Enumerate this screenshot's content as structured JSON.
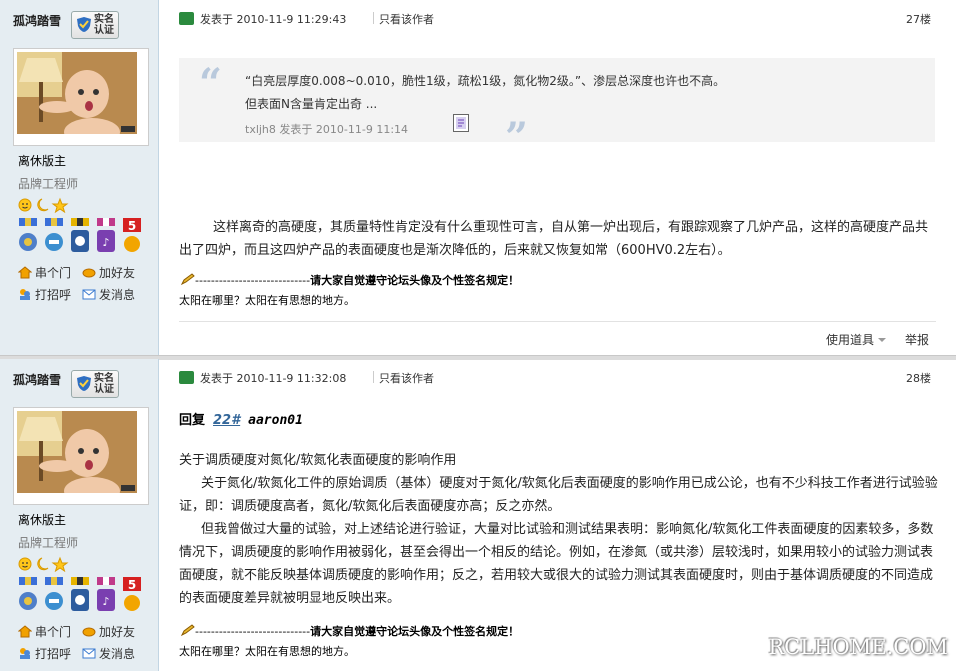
{
  "posts": [
    {
      "author": "孤鸿踏雪",
      "badge_line1": "实名",
      "badge_line2": "认证",
      "rank": "离休版主",
      "title": "品牌工程师",
      "links": {
        "home": "串个门",
        "friend": "加好友",
        "greet": "打招呼",
        "message": "发消息"
      },
      "posted": "发表于 2010-11-9 11:29:43",
      "only_author": "只看该作者",
      "floor": "27楼",
      "quote_line1": "“白亮层厚度0.008~0.010，脆性1级，疏松1级，氮化物2级。”、渗层总深度也许也不高。",
      "quote_line2": "但表面N含量肯定出奇 ...",
      "quote_by": "txljh8 发表于 2010-11-9 11:14",
      "body": "这样离奇的高硬度，其质量特性肯定没有什么重现性可言，自从第一炉出现后，有跟踪观察了几炉产品，这样的高硬度产品共出了四炉，而且这四炉产品的表面硬度也是渐次降低的，后来就又恢复如常（600HV0.2左右）。",
      "sig_dashes": "-----------------------------",
      "sig_rule": "请大家自觉遵守论坛头像及个性签名规定！",
      "motto": "太阳在哪里？太阳在有思想的地方。",
      "tools": "使用道具",
      "report": "举报"
    },
    {
      "author": "孤鸿踏雪",
      "badge_line1": "实名",
      "badge_line2": "认证",
      "rank": "离休版主",
      "title": "品牌工程师",
      "links": {
        "home": "串个门",
        "friend": "加好友",
        "greet": "打招呼",
        "message": "发消息"
      },
      "posted": "发表于 2010-11-9 11:32:08",
      "only_author": "只看该作者",
      "floor": "28楼",
      "reply_label": "回复",
      "reply_floor": "22#",
      "reply_to": "aaron01",
      "p1": "关于调质硬度对氮化/软氮化表面硬度的影响作用",
      "p2": "关于氮化/软氮化工件的原始调质（基体）硬度对于氮化/软氮化后表面硬度的影响作用已成公论，也有不少科技工作者进行试验验证，即：调质硬度高者，氮化/软氮化后表面硬度亦高；反之亦然。",
      "p3": "但我曾做过大量的试验，对上述结论进行验证，大量对比试验和测试结果表明：影响氮化/软氮化工件表面硬度的因素较多，多数情况下，调质硬度的影响作用被弱化，甚至会得出一个相反的结论。例如，在渗氮（或共渗）层较浅时，如果用较小的试验力测试表面硬度，就不能反映基体调质硬度的影响作用；反之，若用较大或很大的试验力测试其表面硬度时，则由于基体调质硬度的不同造成的表面硬度差异就被明显地反映出来。",
      "sig_dashes": "-----------------------------",
      "sig_rule": "请大家自觉遵守论坛头像及个性签名规定！",
      "motto": "太阳在哪里？太阳在有思想的地方。"
    }
  ],
  "watermark": "RCLHOME.COM",
  "colors": {
    "sidebar_bg": "#e5edf2",
    "quote_bg": "#f3f3f3",
    "link_blue": "#336699",
    "online_icon": "#2b8a3e"
  }
}
